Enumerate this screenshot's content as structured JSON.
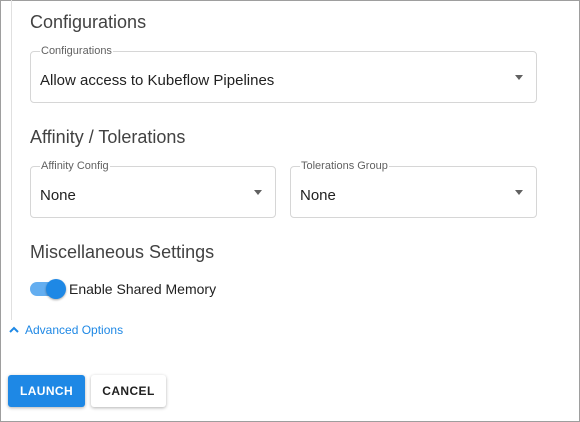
{
  "configurations": {
    "section_title": "Configurations",
    "field_label": "Configurations",
    "value": "Allow access to Kubeflow Pipelines"
  },
  "affinity": {
    "section_title": "Affinity / Tolerations",
    "affinity_label": "Affinity Config",
    "affinity_value": "None",
    "tolerations_label": "Tolerations Group",
    "tolerations_value": "None"
  },
  "misc": {
    "section_title": "Miscellaneous Settings",
    "shared_memory_label": "Enable Shared Memory",
    "shared_memory_enabled": true
  },
  "advanced": {
    "label": "Advanced Options",
    "expanded": true
  },
  "actions": {
    "launch_label": "LAUNCH",
    "cancel_label": "CANCEL"
  },
  "colors": {
    "accent": "#1e88e5",
    "toggle_track": "#64aef0",
    "border": "#d6d6d6"
  }
}
